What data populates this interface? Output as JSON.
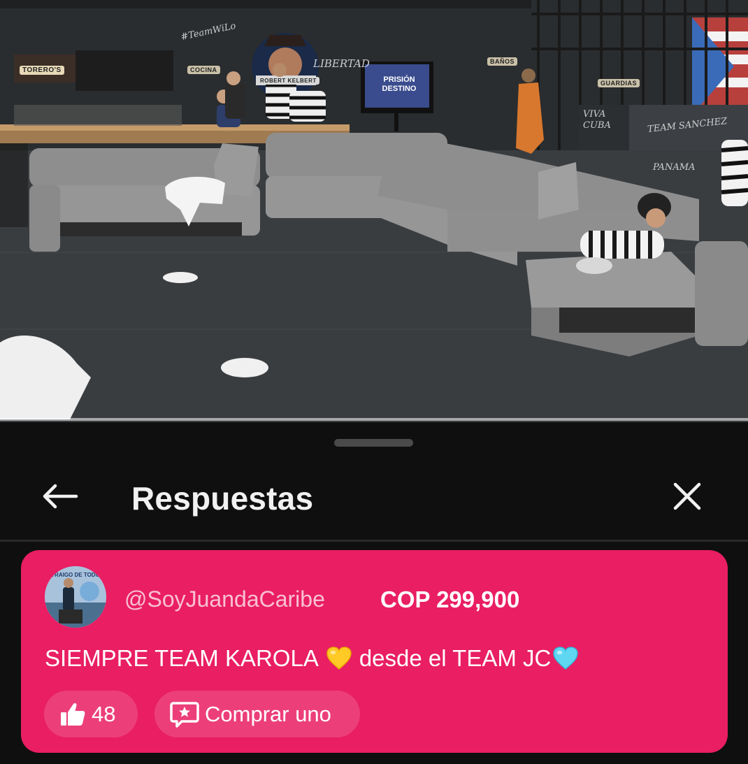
{
  "video": {
    "signs": {
      "toreros": "TORERO'S",
      "cocina": "COCINA",
      "banos": "BAÑOS",
      "guardias": "GUARDIAS",
      "show_logo_line1": "PRISIÓN",
      "show_logo_line2": "DESTINO",
      "chalk_liberta": "LIBERTAD",
      "chalk_team_wilo": "#TeamWiLo",
      "chalk_team_sanchez": "TEAM SANCHEZ",
      "chalk_viva_cuba": "VIVA CUBA",
      "chalk_panama": "PANAMA",
      "poster_name": "ROBERT KELBERT"
    }
  },
  "sheet": {
    "title": "Respuestas",
    "back_icon": "arrow-left-icon",
    "close_icon": "close-icon"
  },
  "superchat": {
    "author": "@SoyJuandaCaribe",
    "amount": "COP 299,900",
    "message_part1": "SIEMPRE TEAM KAROLA",
    "message_part2": "desde el TEAM JC",
    "emoji1": "yellow-heart",
    "emoji2": "light-blue-heart",
    "likes": "48",
    "buy_label": "Comprar uno",
    "card_color": "#e91e63",
    "avatar_text": "TRAIGO DE TODO"
  }
}
